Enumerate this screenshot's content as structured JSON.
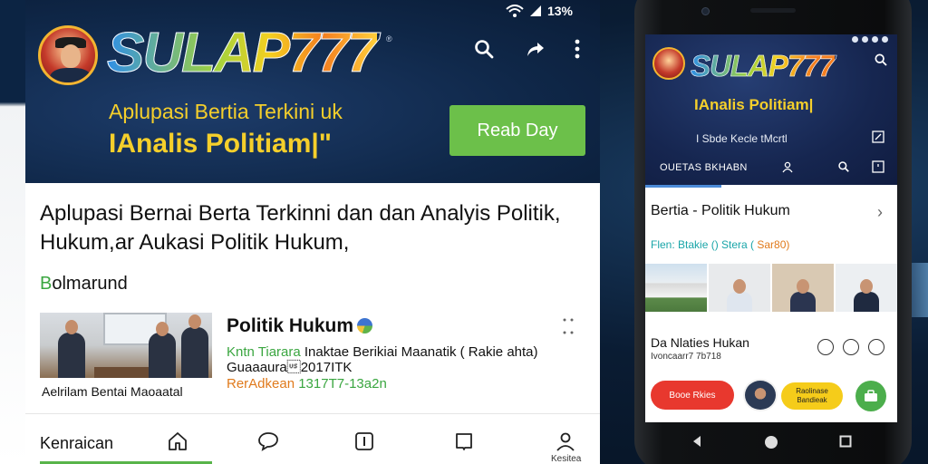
{
  "status_bar": {
    "battery": "13%"
  },
  "hero": {
    "brand": "SULAP777",
    "brand_sup": "®",
    "tagline_line1": "Aplupasi Bertia Terkini uk",
    "tagline_line2": "IAnalis Politiam|\"",
    "read_button": "Reab Day"
  },
  "headline": "Aplupasi Bernai Berta Terkinni dan  dan Analyis Politik, Hukum,ar Aukasi Politik  Hukum,",
  "section_label": {
    "first": "B",
    "rest": "olmarund"
  },
  "article": {
    "thumb_caption": "Aelrilam Bentai Maoaatal",
    "title": "Politik Hukum",
    "subtitle_green": "Kntn Tiarara",
    "subtitle_rest": " Inaktae Berikiai Maanatik ( Rakie ahta) Guaaaura\u001f2017ITK",
    "date_orange": "RerAdkean ",
    "date_green": "1317T7-13a2n"
  },
  "bottom_nav": {
    "label": "Kenraican",
    "profile_label": "Kesitea"
  },
  "phone": {
    "brand": "SULAP777",
    "subtitle": "IAnalis Politiam|",
    "info": "I Sbde Kecle tMcrtl",
    "tab_label": "OUETAS BKHABN",
    "category": "Bertia - Politik Hukum",
    "meta_teal": "Flen: Btakie () Stera ( ",
    "meta_orange": "Sar80)",
    "news_title": "Da Nlaties Hukan",
    "news_date": "Ivoncaarr7 7b718",
    "btn_red": "Booe Rkies",
    "btn_yellow": "Raolinase Bandieak"
  },
  "colors": {
    "navy": "#0f2748",
    "yellow": "#f5cf2b",
    "green": "#6cc04a",
    "red": "#e8382e",
    "orange": "#e07a1c"
  },
  "icons": {
    "hero": [
      "search-icon",
      "share-icon",
      "more-vertical-icon"
    ],
    "nav": [
      "home-icon",
      "chat-icon",
      "info-icon",
      "bookmark-icon",
      "profile-icon"
    ],
    "phone_soft_keys": [
      "back-icon",
      "home-circle-icon",
      "recents-icon"
    ]
  }
}
